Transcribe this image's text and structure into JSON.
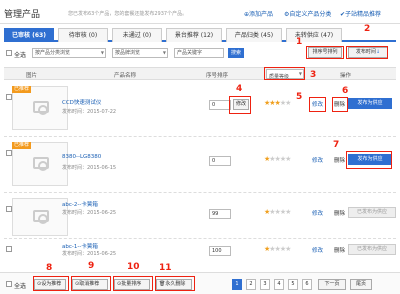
{
  "header": {
    "title": "管理产品",
    "summary": "您已发布63个产品，您的套餐还能发布2937个产品。",
    "add_product": "添加产品",
    "custom_category": "自定义产品分类",
    "featured": "子站精品推荐"
  },
  "tabs": [
    {
      "label": "已审核 (63)"
    },
    {
      "label": "待审核 (0)"
    },
    {
      "label": "未通过 (0)"
    },
    {
      "label": "景台推荐 (12)"
    },
    {
      "label": "产品归类 (45)"
    },
    {
      "label": "未转供应 (47)"
    }
  ],
  "filter": {
    "select_all": "全选",
    "category_placeholder": "按产品分类浏览",
    "brand_placeholder": "按品牌浏览",
    "keyword_placeholder": "产品关键字",
    "search": "搜索",
    "sort_by_number": "排序号排列",
    "publish_time": "发布时间"
  },
  "columns": {
    "image": "图片",
    "name": "产品名称",
    "sort": "序号排序",
    "quality": "质量等级",
    "ops": "操作"
  },
  "rows": [
    {
      "badge": "已推荐",
      "name": "CCD快速测试仪",
      "date": "发布时间：2015-07-22",
      "sort": "0",
      "edit": "修改",
      "edit2": "修改",
      "del": "删除",
      "action": "发布为供应",
      "stars": 3
    },
    {
      "badge": "已推荐",
      "name": "8380--LG8380",
      "date": "发布时间：2015-06-15",
      "sort": "0",
      "edit": "修改",
      "edit2": "修改",
      "del": "删除",
      "action": "发布为供应",
      "stars": 1
    },
    {
      "badge": "",
      "name": "abc-2--卡簧箱",
      "date": "发布时间：2015-06-25",
      "sort": "99",
      "edit": "修改",
      "edit2": "修改",
      "del": "删除",
      "action": "已发布为供应",
      "stars": 1
    },
    {
      "badge": "",
      "name": "abc-1--卡簧箱",
      "date": "发布时间：2015-06-25",
      "sort": "100",
      "edit": "修改",
      "edit2": "修改",
      "del": "删除",
      "action": "已发布为供应",
      "stars": 1
    }
  ],
  "markers": [
    "1",
    "2",
    "3",
    "4",
    "5",
    "6",
    "7",
    "8",
    "9",
    "10",
    "11"
  ],
  "footer": {
    "select_all": "全选",
    "set_recommend": "设为推荐",
    "cancel_recommend": "取消推荐",
    "batch_sort": "批量排序",
    "delete_forever": "永久删除",
    "pages": [
      "1",
      "2",
      "3",
      "4",
      "5",
      "6"
    ],
    "next": "下一页",
    "last": "尾页"
  },
  "colors": {
    "accent": "#2f6fd1",
    "marker": "#e21111",
    "star": "#f0a020"
  }
}
